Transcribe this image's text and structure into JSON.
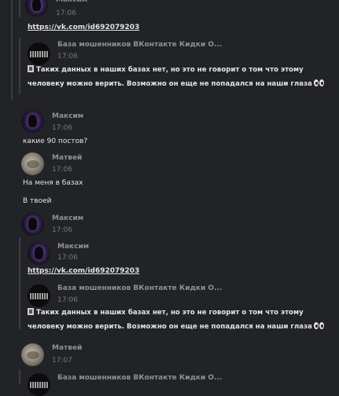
{
  "links": {
    "vk_url": "https://vk.com/id692079203"
  },
  "senders": {
    "maxim": "Максим",
    "matvei": "Матвей",
    "group": "База мошенников ВКонтакте Кидки О..."
  },
  "group_reply": {
    "line1": "Таких данных в наших базах нет, но это не говорит о том что этому",
    "line2": "человеку можно верить. Возможно он еще не попадался на наши глаза",
    "icon_start": "pushpin-icon",
    "icon_end": "eyes-icon"
  },
  "messages": {
    "m0": {
      "time": "17:06"
    },
    "m0_group": {
      "time": "17:06"
    },
    "m1": {
      "time": "17:06",
      "text": "какие 90 постов?"
    },
    "m2": {
      "time": "17:06",
      "text1": "На меня в базах",
      "text2": "В твоей"
    },
    "m3": {
      "time": "17:06"
    },
    "m3_quote": {
      "time": "17:06"
    },
    "m3_group": {
      "time": "17:06"
    },
    "m4": {
      "time": "17:07"
    }
  }
}
